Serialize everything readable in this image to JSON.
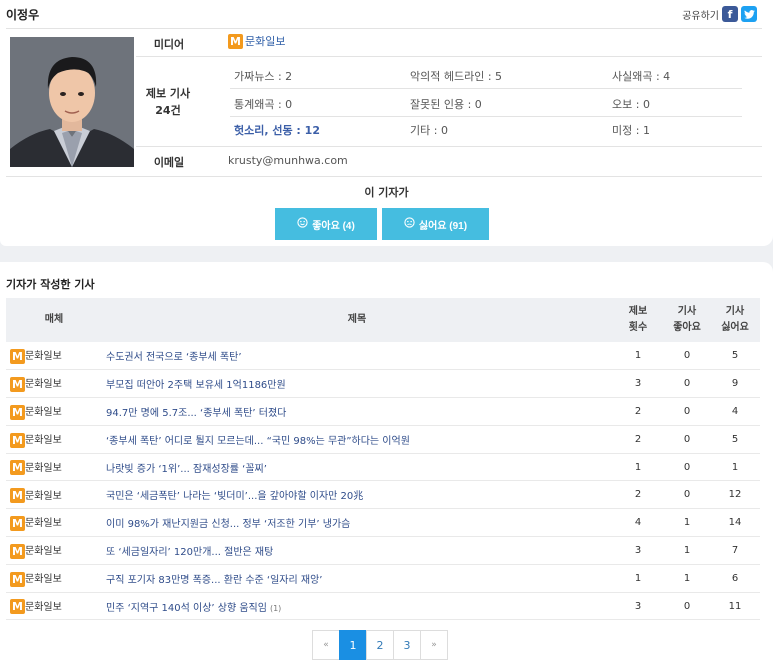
{
  "reporter": {
    "name": "이정우",
    "share_label": "공유하기",
    "media_label": "미디어",
    "media_name": "문화일보",
    "reports_label_1": "제보 기사",
    "reports_label_2": "24건",
    "email_label": "이메일",
    "email": "krusty@munhwa.com",
    "stats": [
      {
        "text": "가짜뉴스 : 2",
        "highlight": false
      },
      {
        "text": "악의적 헤드라인 : 5",
        "highlight": false
      },
      {
        "text": "사실왜곡 : 4",
        "highlight": false
      },
      {
        "text": "통계왜곡 : 0",
        "highlight": false
      },
      {
        "text": "잘못된 인용 : 0",
        "highlight": false
      },
      {
        "text": "오보 : 0",
        "highlight": false
      },
      {
        "text": "헛소리, 선동 : 12",
        "highlight": true
      },
      {
        "text": "기타 : 0",
        "highlight": false
      },
      {
        "text": "미정 : 1",
        "highlight": false
      }
    ],
    "this_reporter_label": "이 기자가",
    "like_label": "좋아요 (4)",
    "dislike_label": "싫어요 (91)"
  },
  "articles": {
    "section_title": "기자가 작성한 기사",
    "headers": {
      "media": "매체",
      "title": "제목",
      "reports_1": "제보",
      "reports_2": "횟수",
      "likes_1": "기사",
      "likes_2": "좋아요",
      "dislikes_1": "기사",
      "dislikes_2": "싫어요"
    },
    "rows": [
      {
        "media": "문화일보",
        "title": "수도권서 전국으로 ‘종부세 폭탄’",
        "comments": "",
        "reports": "1",
        "likes": "0",
        "dislikes": "5"
      },
      {
        "media": "문화일보",
        "title": "부모집 떠안아 2주택 보유세 1억1186만원",
        "comments": "",
        "reports": "3",
        "likes": "0",
        "dislikes": "9"
      },
      {
        "media": "문화일보",
        "title": "94.7만 명에 5.7조... ‘종부세 폭탄’ 터졌다",
        "comments": "",
        "reports": "2",
        "likes": "0",
        "dislikes": "4"
      },
      {
        "media": "문화일보",
        "title": "‘종부세 폭탄’ 어디로 튈지 모르는데... “국민 98%는 무관”하다는 이억원",
        "comments": "",
        "reports": "2",
        "likes": "0",
        "dislikes": "5"
      },
      {
        "media": "문화일보",
        "title": "나랏빚 증가 ‘1위’... 잠재성장률 ‘꼴찌’",
        "comments": "",
        "reports": "1",
        "likes": "0",
        "dislikes": "1"
      },
      {
        "media": "문화일보",
        "title": "국민은 ‘세금폭탄’ 나라는 ‘빚더미’...을 갚아야할 이자만 20兆",
        "comments": "",
        "reports": "2",
        "likes": "0",
        "dislikes": "12"
      },
      {
        "media": "문화일보",
        "title": "이미 98%가 재난지원금 신청... 정부 ‘저조한 기부’ 냉가슴",
        "comments": "",
        "reports": "4",
        "likes": "1",
        "dislikes": "14"
      },
      {
        "media": "문화일보",
        "title": "또 ‘세금일자리’ 120만개... 절반은 재탕",
        "comments": "",
        "reports": "3",
        "likes": "1",
        "dislikes": "7"
      },
      {
        "media": "문화일보",
        "title": "구직 포기자 83만명 폭증... 환란 수준 ‘일자리 재앙’",
        "comments": "",
        "reports": "1",
        "likes": "1",
        "dislikes": "6"
      },
      {
        "media": "문화일보",
        "title": "민주 ‘지역구 140석 이상’ 상향 움직임",
        "comments": "(1)",
        "reports": "3",
        "likes": "0",
        "dislikes": "11"
      }
    ]
  },
  "pagination": {
    "prev": "«",
    "pages": [
      "1",
      "2",
      "3"
    ],
    "next": "»"
  },
  "colors": {
    "accent_button": "#45bde0",
    "media_logo": "#f39a1e",
    "pager_active": "#1a8fe3",
    "highlight_text": "#3c5fa8"
  }
}
